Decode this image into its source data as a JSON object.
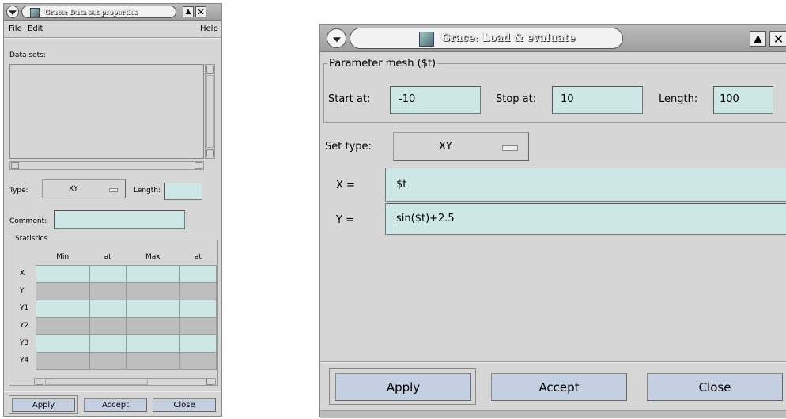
{
  "left_window": {
    "title": "Grace: Data set properties",
    "menu": {
      "file": "File",
      "edit": "Edit",
      "help": "Help"
    },
    "data_sets_label": "Data sets:",
    "type_label": "Type:",
    "type_value": "XY",
    "length_label": "Length:",
    "comment_label": "Comment:",
    "statistics_label": "Statistics",
    "stats_columns": [
      "Min",
      "at",
      "Max",
      "at"
    ],
    "stats_rows": [
      "X",
      "Y",
      "Y1",
      "Y2",
      "Y3",
      "Y4"
    ],
    "buttons": {
      "apply": "Apply",
      "accept": "Accept",
      "close": "Close"
    }
  },
  "right_window": {
    "title": "Grace: Load & evaluate",
    "mesh_group_label": "Parameter mesh ($t)",
    "start_label": "Start at:",
    "start_value": "-10",
    "stop_label": "Stop at:",
    "stop_value": "10",
    "length_label": "Length:",
    "length_value": "100",
    "set_type_label": "Set type:",
    "set_type_value": "XY",
    "x_label": "X =",
    "x_formula": "$t",
    "y_label": "Y =",
    "y_formula": "sin($t)+2.5",
    "buttons": {
      "apply": "Apply",
      "accept": "Accept",
      "close": "Close"
    }
  },
  "colors": {
    "field": "#cde6e6",
    "button": "#c4cfe2",
    "window": "#d6d6d6",
    "grey_row": "#bdbdbd"
  },
  "icons": [
    "window-menu-icon",
    "app-icon",
    "shade-icon",
    "close-icon",
    "option-menu-indicator-icon"
  ]
}
